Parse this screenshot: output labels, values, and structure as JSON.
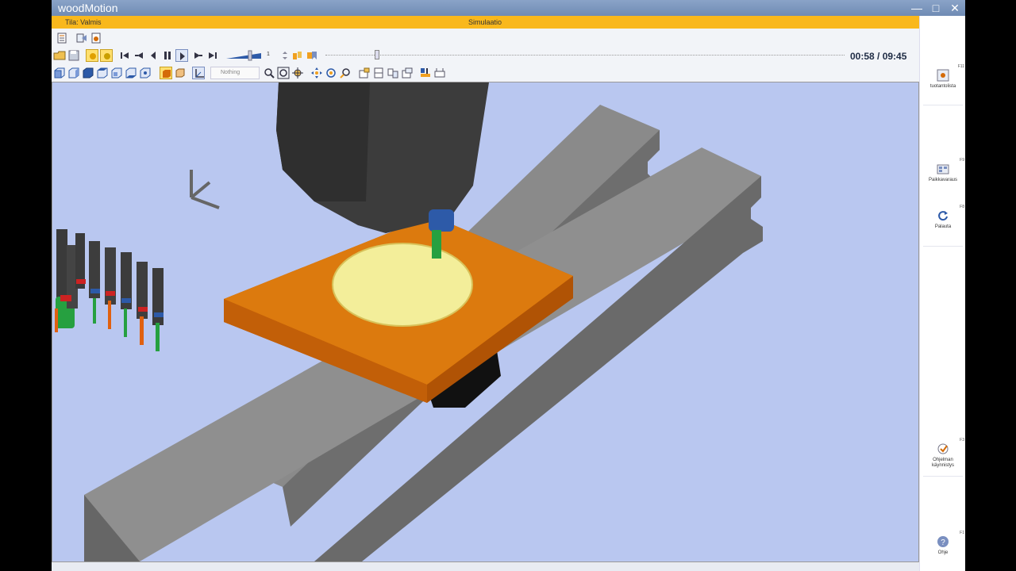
{
  "window": {
    "title": "woodMotion"
  },
  "status": {
    "state": "Tila: Valmis",
    "mode": "Simulaatio"
  },
  "playback": {
    "time": "00:58 / 09:45",
    "speed_value": "1",
    "progress": 0.1
  },
  "toolbar2": {
    "filter_placeholder": "Nothing"
  },
  "sidebar": {
    "items": [
      {
        "label": "tuotantolista",
        "key": "F11",
        "icon": "production-list-icon"
      },
      {
        "label": "Paikkavaraus",
        "key": "F9",
        "icon": "reservation-icon"
      },
      {
        "label": "Palauta",
        "key": "F8",
        "icon": "restore-icon"
      },
      {
        "label": "Ohjelman käynnistys",
        "key": "F3",
        "icon": "program-start-icon"
      },
      {
        "label": "Ohje",
        "key": "F1",
        "icon": "help-icon"
      }
    ]
  },
  "colors": {
    "status_bar": "#f9b81c",
    "title_bar": "#7a93bc",
    "viewport_bg": "#b9c7f0",
    "workpiece": "#d9760a",
    "pocket": "#f3ee9a",
    "rail": "#7a7a7a"
  }
}
